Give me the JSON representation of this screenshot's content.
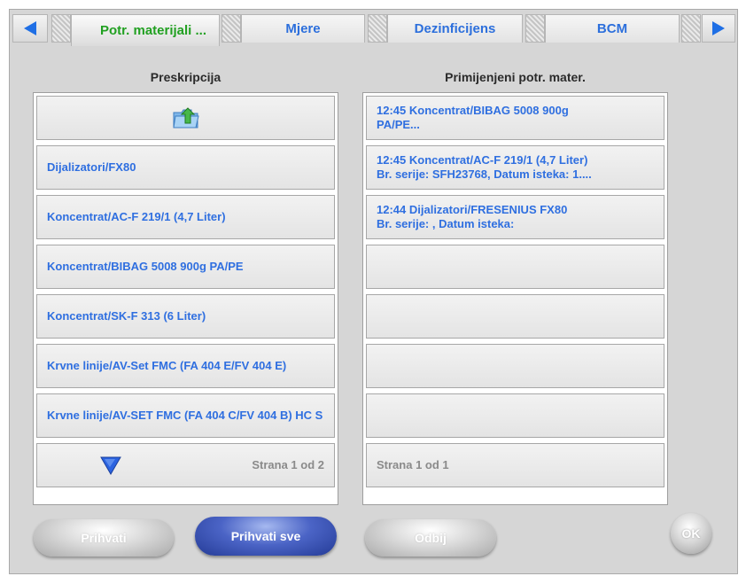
{
  "tabs": {
    "items": [
      {
        "label": "Potr. materijali ..."
      },
      {
        "label": "Mjere"
      },
      {
        "label": "Dezinficijens"
      },
      {
        "label": "BCM"
      }
    ],
    "active_index": 0
  },
  "prescription": {
    "title": "Preskripcija",
    "up_folder_icon": "folder-up-icon",
    "items": [
      {
        "label": "Dijalizatori/FX80"
      },
      {
        "label": "Koncentrat/AC-F 219/1 (4,7 Liter)"
      },
      {
        "label": "Koncentrat/BIBAG 5008 900g PA/PE"
      },
      {
        "label": "Koncentrat/SK-F 313 (6 Liter)"
      },
      {
        "label": "Krvne linije/AV-Set FMC (FA 404 E/FV 404 E)"
      },
      {
        "label": "Krvne linije/AV-SET FMC (FA 404 C/FV 404 B) HC S"
      }
    ],
    "pager": "Strana 1 od 2",
    "scroll_down_icon": "triangle-down-icon"
  },
  "applied": {
    "title": "Primijenjeni potr. mater.",
    "items": [
      {
        "line1": "12:45 Koncentrat/BIBAG 5008 900g",
        "line2": "PA/PE..."
      },
      {
        "line1": "12:45 Koncentrat/AC-F 219/1 (4,7 Liter)",
        "line2": "Br. serije: SFH23768, Datum isteka: 1...."
      },
      {
        "line1": "12:44 Dijalizatori/FRESENIUS FX80",
        "line2": "Br. serije: , Datum isteka:"
      }
    ],
    "pager": "Strana 1 od 1"
  },
  "buttons": {
    "accept": "Prihvati",
    "accept_all": "Prihvati sve",
    "reject": "Odbij",
    "ok": "OK"
  },
  "colors": {
    "accent_blue": "#2f6fe0",
    "active_tab_green": "#21a021",
    "primary_button": "#3a55b8"
  }
}
